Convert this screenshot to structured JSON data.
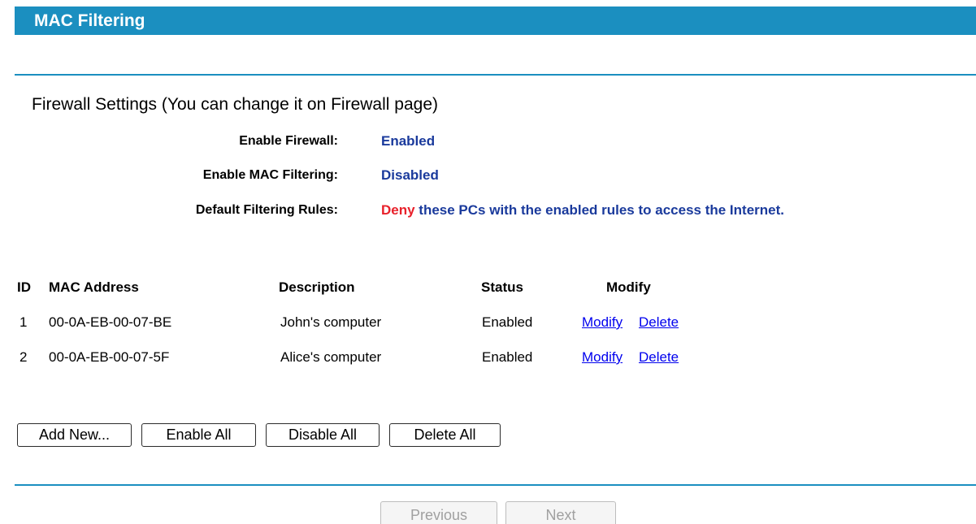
{
  "header": {
    "title": "MAC Filtering"
  },
  "firewall": {
    "section_title": "Firewall Settings (You can change it on Firewall page)",
    "enable_firewall_label": "Enable Firewall:",
    "enable_firewall_value": "Enabled",
    "enable_mac_label": "Enable MAC Filtering:",
    "enable_mac_value": "Disabled",
    "default_rules_label": "Default Filtering Rules:",
    "default_rules_deny": "Deny",
    "default_rules_text": " these PCs with the enabled rules to access the Internet."
  },
  "table": {
    "headers": {
      "id": "ID",
      "mac": "MAC Address",
      "description": "Description",
      "status": "Status",
      "modify": "Modify"
    },
    "rows": [
      {
        "id": "1",
        "mac": "00-0A-EB-00-07-BE",
        "description": "John's computer",
        "status": "Enabled",
        "modify_link": "Modify",
        "delete_link": "Delete"
      },
      {
        "id": "2",
        "mac": "00-0A-EB-00-07-5F",
        "description": "Alice's computer",
        "status": "Enabled",
        "modify_link": "Modify",
        "delete_link": "Delete"
      }
    ]
  },
  "actions": {
    "add_new": "Add New...",
    "enable_all": "Enable All",
    "disable_all": "Disable All",
    "delete_all": "Delete All"
  },
  "pager": {
    "previous": "Previous",
    "next": "Next"
  },
  "colors": {
    "accent": "#1b8fc0",
    "value_text": "#1a3a9c",
    "deny": "#e8202a",
    "link": "#0000ee"
  }
}
